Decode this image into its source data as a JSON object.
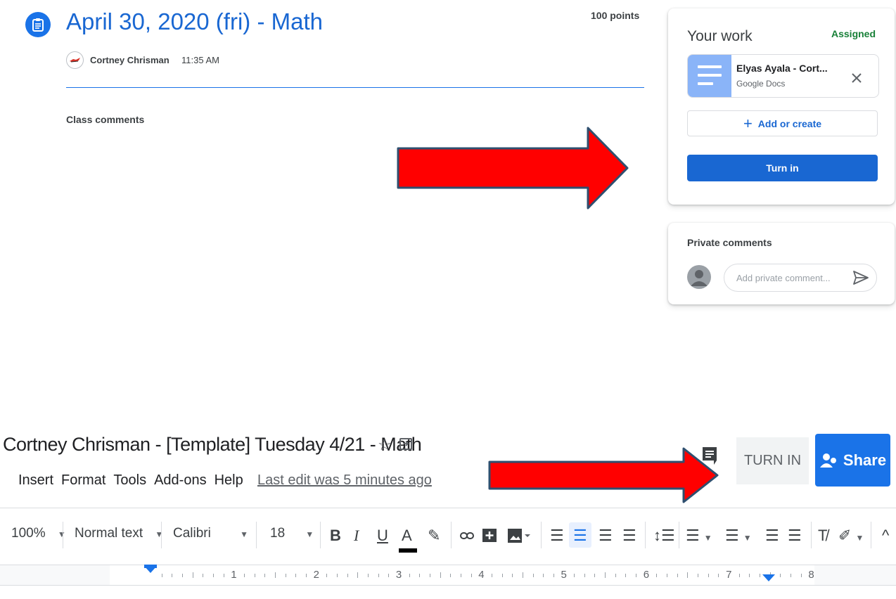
{
  "assignment": {
    "title": "April 30, 2020 (fri) - Math",
    "points": "100 points",
    "author": "Cortney Chrisman",
    "time": "11:35 AM",
    "class_comments_label": "Class comments"
  },
  "your_work": {
    "title": "Your work",
    "status": "Assigned",
    "status_color": "#188038",
    "attachment": {
      "name": "Elyas Ayala - Cort...",
      "type": "Google Docs"
    },
    "add_label": "Add or create",
    "turn_in_label": "Turn in"
  },
  "private_comments": {
    "title": "Private comments",
    "placeholder": "Add private comment..."
  },
  "docs": {
    "title": "Cortney Chrisman - [Template] Tuesday 4/21 - Math",
    "turn_in_label": "TURN IN",
    "share_label": "Share",
    "menu": [
      "Insert",
      "Format",
      "Tools",
      "Add-ons",
      "Help"
    ],
    "last_edit": "Last edit was 5 minutes ago",
    "toolbar": {
      "zoom": "100%",
      "style": "Normal text",
      "font": "Calibri",
      "size": "18"
    },
    "ruler_numbers": [
      "1",
      "2",
      "3",
      "4",
      "5",
      "6",
      "7",
      "8"
    ]
  },
  "colors": {
    "accent": "#1a73e8",
    "arrow": "#ff0000"
  }
}
